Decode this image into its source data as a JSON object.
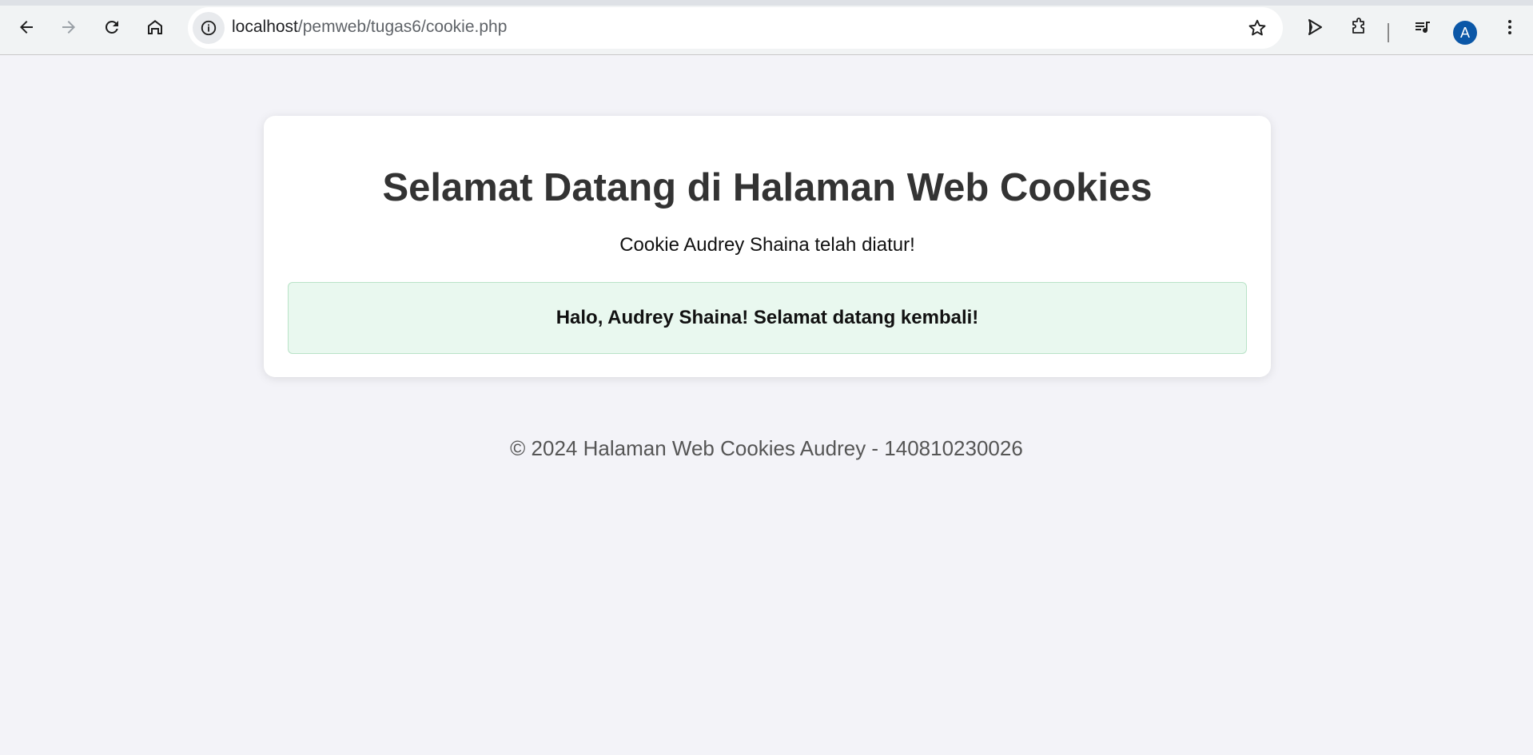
{
  "browser": {
    "url_host": "localhost",
    "url_path": "/pemweb/tugas6/cookie.php",
    "profile_initial": "A",
    "icons": [
      "back-icon",
      "forward-icon",
      "reload-icon",
      "home-icon",
      "site-info-icon",
      "bookmark-star-icon",
      "send-cursor-icon",
      "extensions-icon",
      "media-controls-icon",
      "profile-avatar",
      "menu-dots-icon"
    ]
  },
  "page": {
    "title": "Selamat Datang di Halaman Web Cookies",
    "subtitle": "Cookie Audrey Shaina telah diatur!",
    "greeting": "Halo, Audrey Shaina! Selamat datang kembali!",
    "footer": "© 2024 Halaman Web Cookies Audrey - 140810230026"
  },
  "colors": {
    "background": "#f3f3f8",
    "card": "#ffffff",
    "greeting_bg": "#e9f8ef",
    "greeting_border": "#b9e3c7",
    "avatar": "#0b57a7"
  }
}
